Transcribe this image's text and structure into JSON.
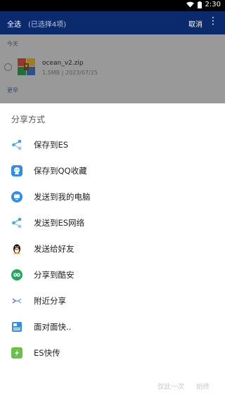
{
  "status_bar": {
    "time": "2:30"
  },
  "app_bar": {
    "select_all": "全选",
    "selected_count": "(已选择4项)",
    "cancel": "取消",
    "more": "⋮"
  },
  "list": {
    "today_header": "今天",
    "file": {
      "name": "ocean_v2.zip",
      "meta": "1.5MB | 2023/07/25"
    },
    "earlier_header": "更早"
  },
  "sheet": {
    "title": "分享方式",
    "items": [
      {
        "label": "保存到ES",
        "icon": "share-nodes-icon",
        "color": "#3fa2e6"
      },
      {
        "label": "保存到QQ收藏",
        "icon": "qq-favorites-icon",
        "color": "#2e8ee8"
      },
      {
        "label": "发送到我的电脑",
        "icon": "computer-icon",
        "color": "#2e8ee8"
      },
      {
        "label": "发送到ES网络",
        "icon": "share-nodes-icon",
        "color": "#3fa2e6"
      },
      {
        "label": "发送给好友",
        "icon": "qq-penguin-icon",
        "color": "#111111"
      },
      {
        "label": "分享到酷安",
        "icon": "coolapk-icon",
        "color": "#1eaa5b"
      },
      {
        "label": "附近分享",
        "icon": "nearby-share-icon",
        "color": "#4a6bd8"
      },
      {
        "label": "面对面快..",
        "icon": "face-to-face-icon",
        "color": "#2e8ee8"
      },
      {
        "label": "ES快传",
        "icon": "es-transfer-icon",
        "color": "#6cc04a"
      }
    ],
    "btn_once": "仅此一次",
    "btn_always": "始终"
  }
}
